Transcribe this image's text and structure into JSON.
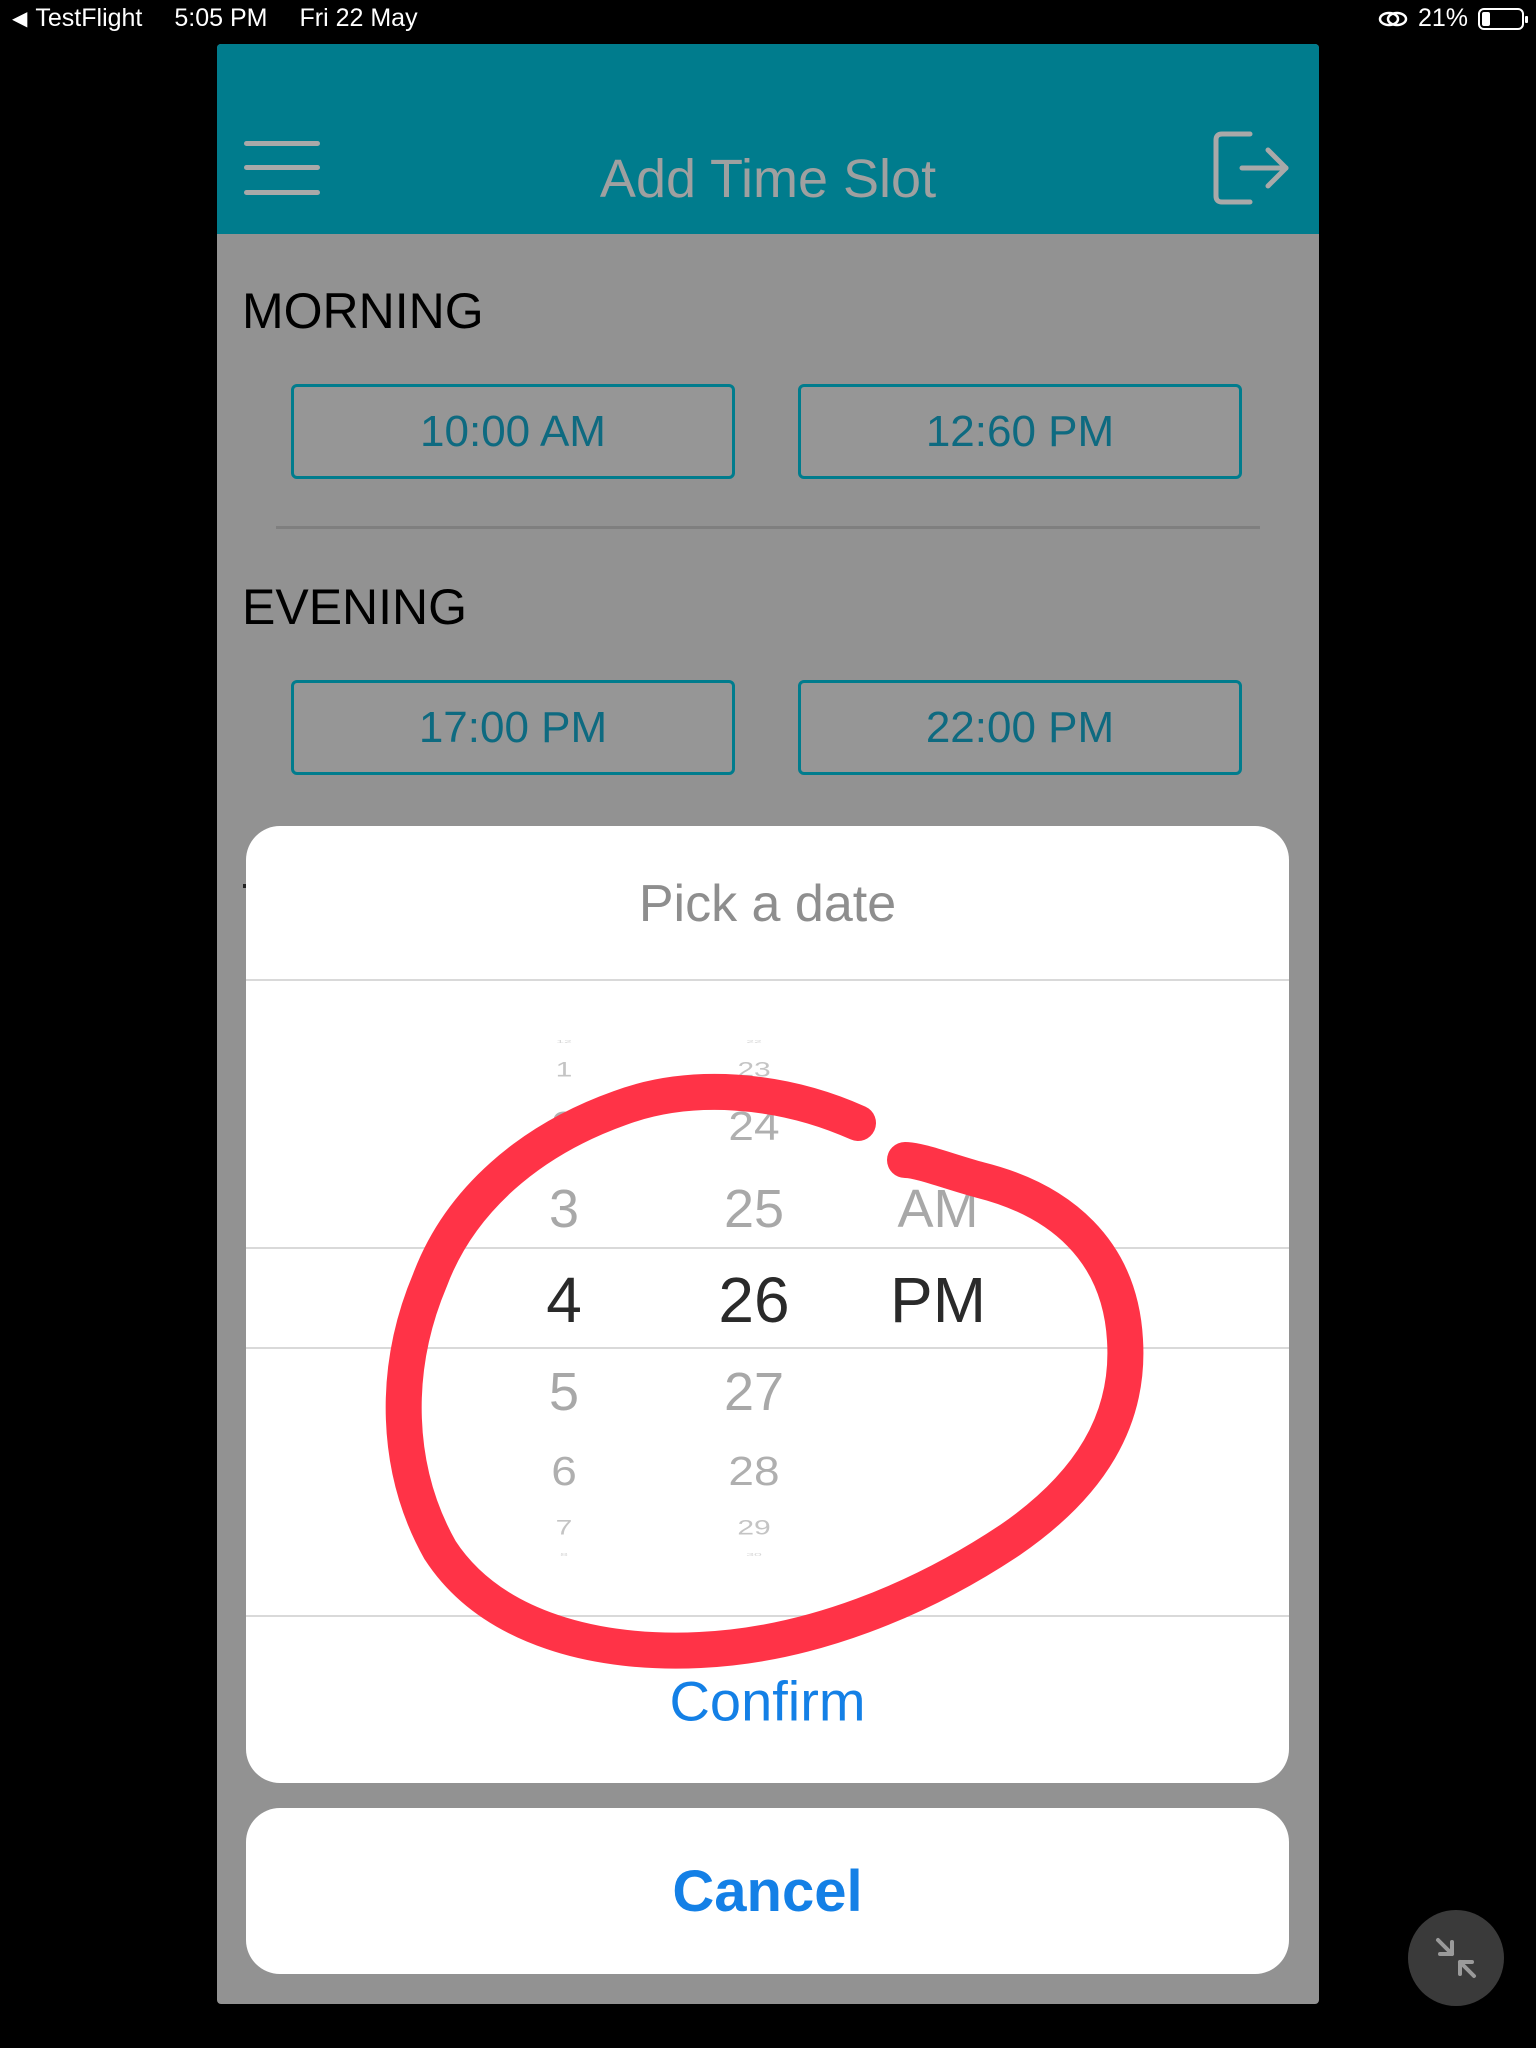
{
  "status_bar": {
    "back_app": "TestFlight",
    "time": "5:05 PM",
    "date": "Fri 22 May",
    "battery": "21%",
    "battery_level": 0.21
  },
  "nav": {
    "title": "Add Time Slot",
    "menu_icon": "hamburger-menu-icon",
    "logout_icon": "logout-icon",
    "bar_color": "#007C8D"
  },
  "sections": {
    "morning": {
      "title": "MORNING",
      "start": "10:00 AM",
      "end": "12:60 PM"
    },
    "evening": {
      "title": "EVENING",
      "start": "17:00 PM",
      "end": "22:00 PM"
    }
  },
  "picker": {
    "title": "Pick a date",
    "hours": [
      "12",
      "1",
      "2",
      "3",
      "4",
      "5",
      "6",
      "7",
      "8"
    ],
    "minutes": [
      "22",
      "23",
      "24",
      "25",
      "26",
      "27",
      "28",
      "29",
      "30"
    ],
    "periods": [
      "AM",
      "PM"
    ],
    "selected": {
      "hour": "4",
      "minute": "26",
      "period": "PM"
    },
    "confirm_label": "Confirm",
    "cancel_label": "Cancel"
  },
  "colors": {
    "accent_blue": "#1480E6",
    "annotation_red": "#FF3347",
    "overlay_gray": "#929292"
  },
  "floating_button": {
    "icon": "collapse-arrows-icon"
  }
}
